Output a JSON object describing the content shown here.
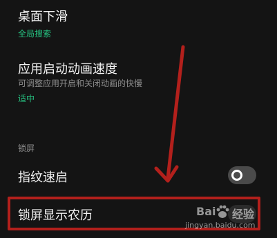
{
  "settings": {
    "desktop_swipe": {
      "title": "桌面下滑",
      "value": "全局搜索"
    },
    "app_animation": {
      "title": "应用启动动画速度",
      "desc": "可调整应用开启和关闭动画的快慢",
      "value": "适中"
    },
    "lock_section": {
      "label": "锁屏"
    },
    "fingerprint": {
      "title": "指纹速启",
      "toggle_state": "off"
    },
    "lunar": {
      "title": "锁屏显示农历"
    }
  },
  "watermark": {
    "logo_a": "Bai",
    "logo_b": "经验",
    "url": "jingyan.baidu.com"
  },
  "colors": {
    "background": "#141414",
    "accent_green": "#26c281",
    "annotation_red": "#b3201c"
  }
}
